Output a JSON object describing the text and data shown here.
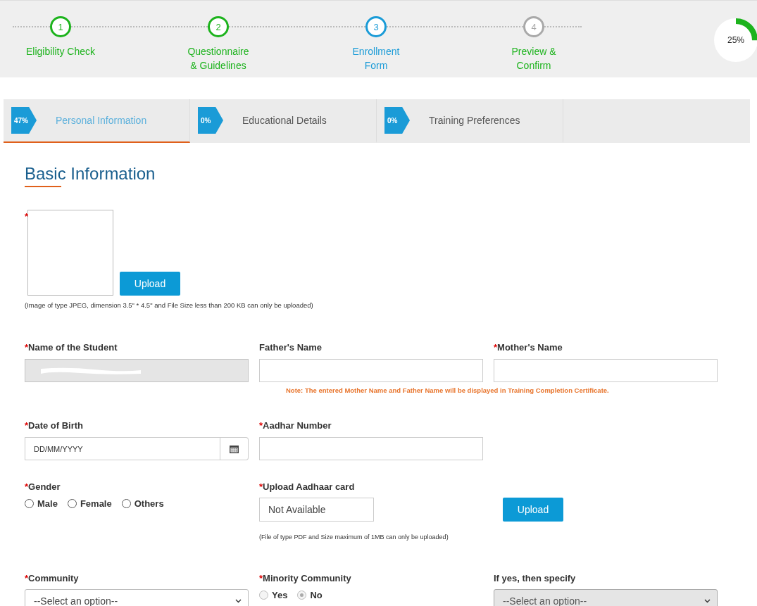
{
  "steps": [
    {
      "number": "1",
      "label": "Eligibility Check",
      "completed": true,
      "selected": false
    },
    {
      "number": "2",
      "label": "Questionnaire\n& Guidelines",
      "completed": true,
      "selected": false
    },
    {
      "number": "3",
      "label": "Enrollment\nForm",
      "completed": false,
      "selected": true
    },
    {
      "number": "4",
      "label": "Preview &\nConfirm",
      "completed": false,
      "selected": false
    }
  ],
  "overall_progress": {
    "label": "25%",
    "level": 0.25
  },
  "tabs": [
    {
      "percent": "47%",
      "label": "Personal Information",
      "selected": true
    },
    {
      "percent": "0%",
      "label": "Educational Details",
      "selected": false
    },
    {
      "percent": "0%",
      "label": "Training Preferences",
      "selected": false
    }
  ],
  "section_title": "Basic Information",
  "photo": {
    "required_mark": "*",
    "button": "Upload",
    "note": "(Image of type JPEG, dimension 3.5\" * 4.5\" and File Size less than 200 KB can only be uploaded)"
  },
  "rows": [
    {
      "fields": [
        {
          "kind": "text",
          "required_mark": "*",
          "label": "Name of the Student",
          "disabled": true,
          "redacted": true
        },
        {
          "kind": "text",
          "label": "Father's Name",
          "disabled": false
        },
        {
          "kind": "text",
          "required_mark": "*",
          "label": "Mother's Name",
          "disabled": false
        }
      ],
      "note": "Note: The entered Mother Name and Father Name will be displayed in Training Completion Certificate."
    },
    {
      "fields": [
        {
          "kind": "date",
          "required_mark": "*",
          "label": "Date of Birth",
          "placeholder": "DD/MM/YYYY"
        },
        {
          "kind": "text",
          "required_mark": "*",
          "label": "Aadhar Number",
          "disabled": false
        }
      ]
    },
    {
      "fields": [
        {
          "kind": "radio",
          "required_mark": "*",
          "label": "Gender",
          "disabled": false,
          "options": [
            {
              "label": "Male",
              "selected": false
            },
            {
              "label": "Female",
              "selected": false
            },
            {
              "label": "Others",
              "selected": false
            }
          ]
        },
        {
          "kind": "file",
          "required_mark": "*",
          "label": "Upload Aadhaar card",
          "value": "Not Available",
          "button": "Upload",
          "note": "(File of type PDF and Size maximum of 1MB can only be uploaded)"
        }
      ]
    },
    {
      "fields": [
        {
          "kind": "select",
          "required_mark": "*",
          "label": "Community",
          "disabled": false,
          "value": "--Select an option--"
        },
        {
          "kind": "radio",
          "required_mark": "*",
          "label": "Minority Community",
          "disabled": true,
          "options": [
            {
              "label": "Yes",
              "selected": false
            },
            {
              "label": "No",
              "selected": true
            }
          ]
        },
        {
          "kind": "select",
          "label": "If yes, then specify",
          "disabled": true,
          "value": "--Select an option--"
        }
      ]
    }
  ]
}
